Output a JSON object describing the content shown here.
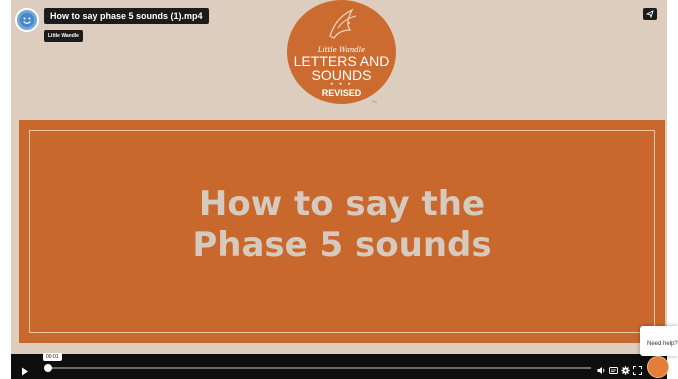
{
  "header": {
    "video_title": "How to say phase 5 sounds (1).mp4",
    "channel_name": "Little Wandle"
  },
  "logo": {
    "small_text": "Little Wandle",
    "line1": "LETTERS AND",
    "line2": "SOUNDS",
    "stars": "★ ★ ★",
    "revised": "REVISED",
    "trademark": "TM"
  },
  "slide": {
    "heading_line1": "How to say the",
    "heading_line2": "Phase 5 sounds"
  },
  "player": {
    "current_time": "00:01",
    "progress_fraction": 0.005
  },
  "help": {
    "text": "Need help?"
  },
  "colors": {
    "accent_orange": "#c9682c",
    "background": "#ddcdbf",
    "heading_text": "#d6c9be"
  },
  "icons": {
    "share": "share-icon",
    "play": "play-icon",
    "volume": "volume-icon",
    "captions": "captions-icon",
    "settings": "gear-icon",
    "fullscreen": "fullscreen-icon"
  }
}
